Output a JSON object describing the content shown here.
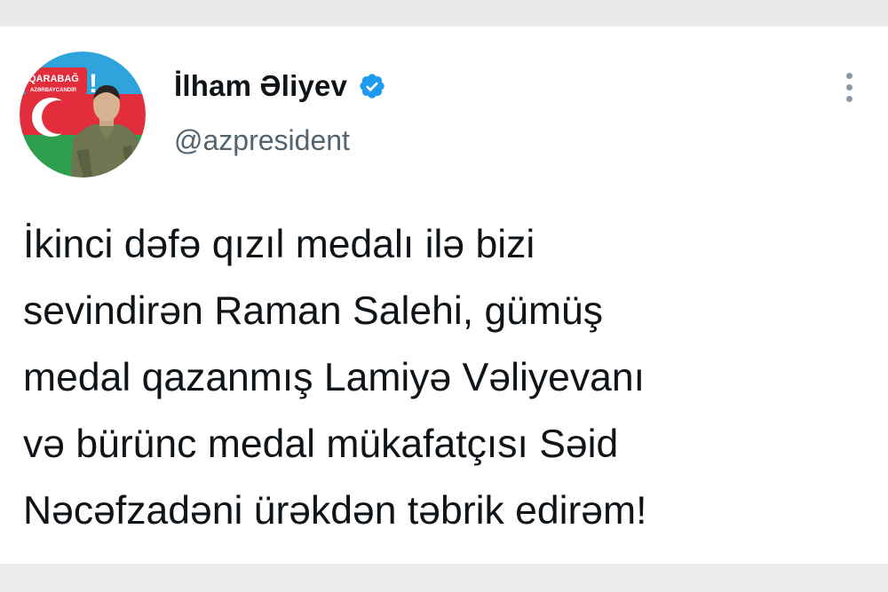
{
  "tweet": {
    "author": {
      "display_name": "İlham Əliyev",
      "handle": "@azpresident",
      "verified": true,
      "avatar": {
        "badge_text_top": "QARABAĞ",
        "badge_text_bottom": "AZƏRBAYCANDIR",
        "badge_exclaim": "!"
      }
    },
    "text_lines": [
      "İkinci dəfə qızıl medalı ilə bizi",
      "sevindirən Raman Salehi, gümüş",
      "medal qazanmış Lamiyə Vəliyevanı",
      "və bürünc medal mükafatçısı Səid",
      "Nəcəfzadəni ürəkdən təbrik edirəm!"
    ],
    "more_icon": "more-vertical-icon",
    "verified_icon": "verified-badge-icon"
  },
  "colors": {
    "text": "#0f1419",
    "handle": "#536471",
    "verified": "#1d9bf0",
    "flag_blue": "#2fa3dc",
    "flag_red": "#e22d3d",
    "flag_green": "#2e9e4f"
  }
}
